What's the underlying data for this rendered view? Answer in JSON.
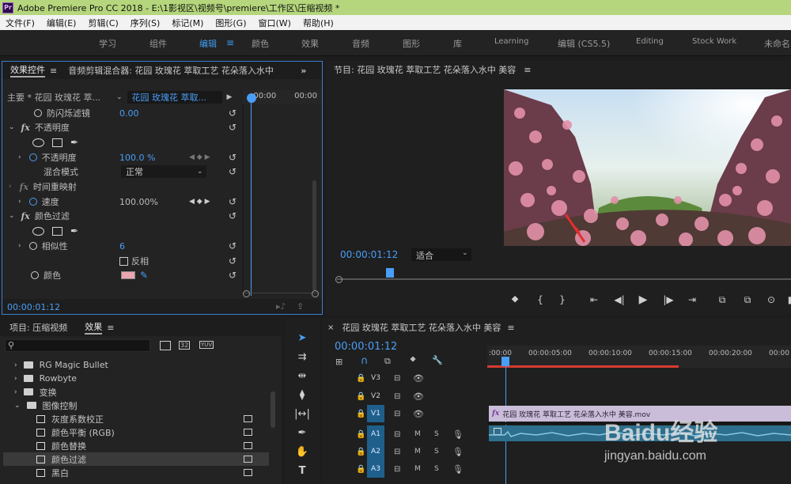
{
  "title_bar": {
    "icon": "Pr",
    "title": "Adobe Premiere Pro CC 2018 - E:\\1影视区\\视频号\\premiere\\工作区\\压缩视频 *"
  },
  "menu": [
    "文件(F)",
    "编辑(E)",
    "剪辑(C)",
    "序列(S)",
    "标记(M)",
    "图形(G)",
    "窗口(W)",
    "帮助(H)"
  ],
  "workspaces": [
    "学习",
    "组件",
    "编辑",
    "颜色",
    "效果",
    "音频",
    "图形",
    "库",
    "Learning",
    "编辑 (CS5.5)",
    "Editing",
    "Stock Work",
    "未命名"
  ],
  "workspace_active": "编辑",
  "effect_controls": {
    "tab": "效果控件",
    "tab2": "音频剪辑混合器: 花园 玫瑰花 萃取工艺 花朵落入水中",
    "master": "主要 * 花园 玫瑰花 萃...",
    "clip": "花园 玫瑰花 萃取...",
    "ruler_start": ":00:00",
    "ruler_end": "00:00",
    "flicker": "防闪烁滤镜",
    "flicker_val": "0.00",
    "opacity_group": "不透明度",
    "opacity": "不透明度",
    "opacity_val": "100.0 %",
    "blend": "混合模式",
    "blend_val": "正常",
    "time_remap": "时间重映射",
    "speed": "速度",
    "speed_val": "100.00%",
    "leave_color": "颜色过滤",
    "similarity": "相似性",
    "similarity_val": "6",
    "reverse": "反相",
    "color": "颜色",
    "color_swatch": "#e8a6b0",
    "timecode": "00:00:01:12"
  },
  "program": {
    "title": "节目: 花园 玫瑰花 萃取工艺 花朵落入水中 美容",
    "timecode": "00:00:01:12",
    "fit": "适合"
  },
  "project": {
    "tab1": "项目: 压缩视频",
    "tab2": "效果",
    "badges": [
      "32",
      "YUV"
    ],
    "tree": [
      {
        "type": "folder",
        "label": "RG Magic Bullet"
      },
      {
        "type": "folder",
        "label": "Rowbyte"
      },
      {
        "type": "folder",
        "label": "变换"
      },
      {
        "type": "folder",
        "label": "图像控制",
        "open": true
      },
      {
        "type": "fx",
        "label": "灰度系数校正"
      },
      {
        "type": "fx",
        "label": "颜色平衡 (RGB)"
      },
      {
        "type": "fx",
        "label": "颜色替换"
      },
      {
        "type": "fx",
        "label": "颜色过滤",
        "selected": true
      },
      {
        "type": "fx",
        "label": "黑白"
      }
    ]
  },
  "timeline": {
    "title": "花园 玫瑰花 萃取工艺 花朵落入水中 美容",
    "timecode": "00:00:01:12",
    "ruler": [
      ":00:00",
      "00:00:05:00",
      "00:00:10:00",
      "00:00:15:00",
      "00:00:20:00",
      "00:00"
    ],
    "video_tracks": [
      "V3",
      "V2",
      "V1"
    ],
    "audio_tracks": [
      "A1",
      "A2",
      "A3"
    ],
    "track_buttons": {
      "mute": "M",
      "solo": "S"
    },
    "clip_label": "花园 玫瑰花 萃取工艺 花朵落入水中 美容.mov"
  },
  "watermark": {
    "brand": "Baidu经验",
    "url": "jingyan.baidu.com"
  }
}
